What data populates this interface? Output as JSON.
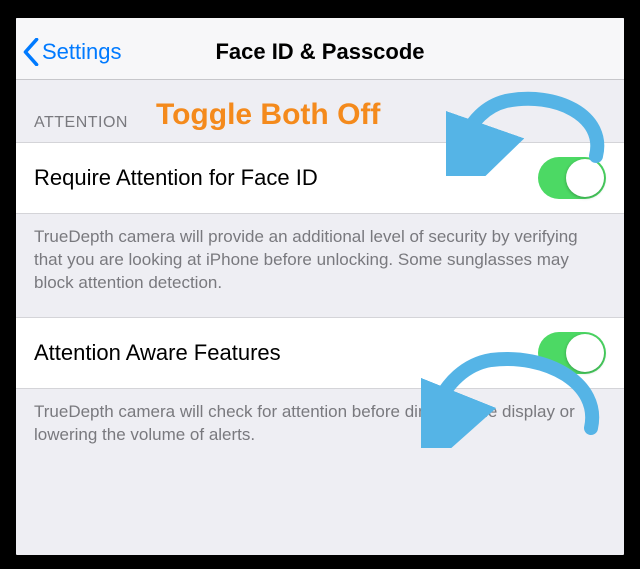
{
  "nav": {
    "back_label": "Settings",
    "title": "Face ID & Passcode"
  },
  "annotation": {
    "text": "Toggle Both Off"
  },
  "section": {
    "header": "ATTENTION"
  },
  "row1": {
    "label": "Require Attention for Face ID",
    "footer": "TrueDepth camera will provide an additional level of security by verifying that you are looking at iPhone before unlocking. Some sunglasses may block attention detection."
  },
  "row2": {
    "label": "Attention Aware Features",
    "footer": "TrueDepth camera will check for attention before dimming the display or lowering the volume of alerts."
  }
}
